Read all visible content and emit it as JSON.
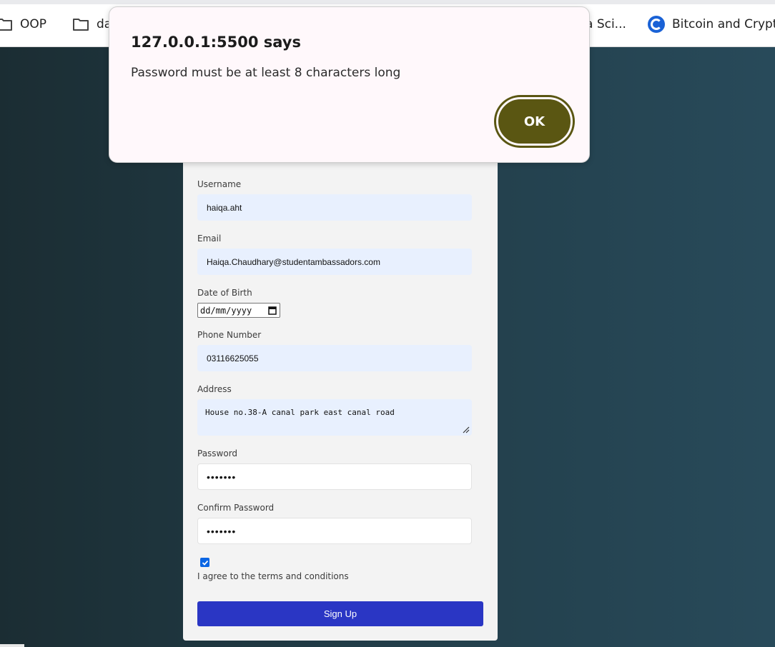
{
  "bookmarks": [
    {
      "label": "OOP",
      "icon": "folder-icon"
    },
    {
      "label": "da",
      "icon": "folder-icon"
    },
    {
      "label": "a Sci...",
      "icon": "none"
    },
    {
      "label": "Bitcoin and Crypto",
      "icon": "c-logo-icon"
    }
  ],
  "dialog": {
    "title": "127.0.0.1:5500 says",
    "message": "Password must be at least 8 characters long",
    "ok_label": "OK"
  },
  "form": {
    "username": {
      "label": "Username",
      "value": "haiqa.aht"
    },
    "email": {
      "label": "Email",
      "value": "Haiqa.Chaudhary@studentambassadors.com"
    },
    "dob": {
      "label": "Date of Birth",
      "value": "dd/mm/yyyy"
    },
    "phone": {
      "label": "Phone Number",
      "value": "03116625055"
    },
    "address": {
      "label": "Address",
      "value": "House no.38-A canal park east canal road"
    },
    "password": {
      "label": "Password",
      "value": "•••••••"
    },
    "confirm_password": {
      "label": "Confirm Password",
      "value": "•••••••"
    },
    "terms": {
      "label": "I agree to the terms and conditions",
      "checked": true
    },
    "submit_label": "Sign Up"
  },
  "colors": {
    "accent": "#2a36c4",
    "ok_button": "#5a5612",
    "autofill": "#e8f0fe",
    "checkbox": "#0b66e4"
  }
}
